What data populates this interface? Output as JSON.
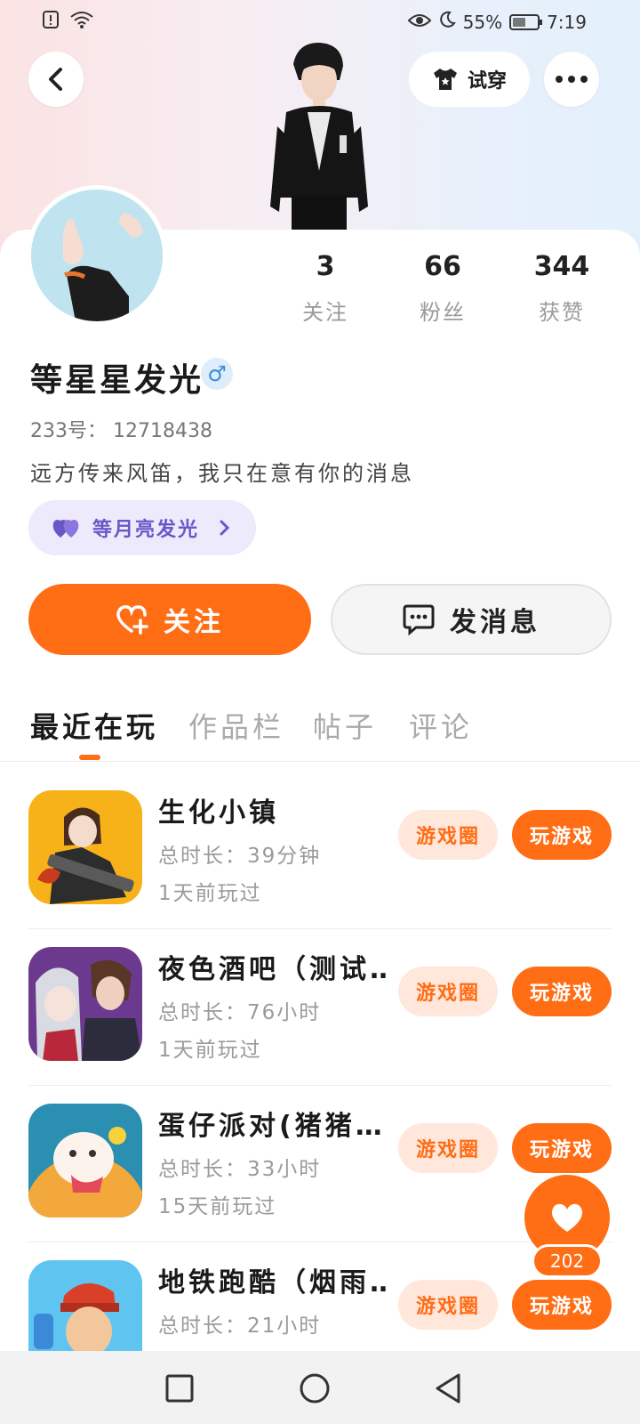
{
  "status_bar": {
    "battery": "55%",
    "time": "7:19",
    "battery_level": 0.55
  },
  "header": {
    "back_icon": "chevron-left-icon",
    "try_on_label": "试穿",
    "more_icon": "more-horizontal-icon"
  },
  "profile": {
    "stats": [
      {
        "num": "3",
        "label": "关注"
      },
      {
        "num": "66",
        "label": "粉丝"
      },
      {
        "num": "344",
        "label": "获赞"
      }
    ],
    "name": "等星星发光",
    "gender_icon": "male-icon",
    "uid": "233号：  12718438",
    "bio": "远方传来风笛，我只在意有你的消息",
    "tag": "等月亮发光"
  },
  "actions": {
    "follow_label": "关注",
    "message_label": "发消息"
  },
  "tabs": [
    "最近在玩",
    "作品栏",
    "帖子",
    "评论"
  ],
  "games": [
    {
      "title": "生化小镇",
      "time": "总时长：39分钟",
      "last": "1天前玩过",
      "circle": "游戏圈",
      "play": "玩游戏"
    },
    {
      "title": "夜色酒吧（测试…",
      "time": "总时长：76小时",
      "last": "1天前玩过",
      "circle": "游戏圈",
      "play": "玩游戏"
    },
    {
      "title": "蛋仔派对(猪猪…",
      "time": "总时长：33小时",
      "last": "15天前玩过",
      "circle": "游戏圈",
      "play": "玩游戏"
    },
    {
      "title": "地铁跑酷（烟雨…",
      "time": "总时长：21小时",
      "last": "",
      "circle": "游戏圈",
      "play": "玩游戏"
    }
  ],
  "like_fab": {
    "count": "202"
  },
  "colors": {
    "accent": "#ff6d15",
    "tag_purple": "#6b56c8",
    "gray_text": "#9a9a9a"
  }
}
